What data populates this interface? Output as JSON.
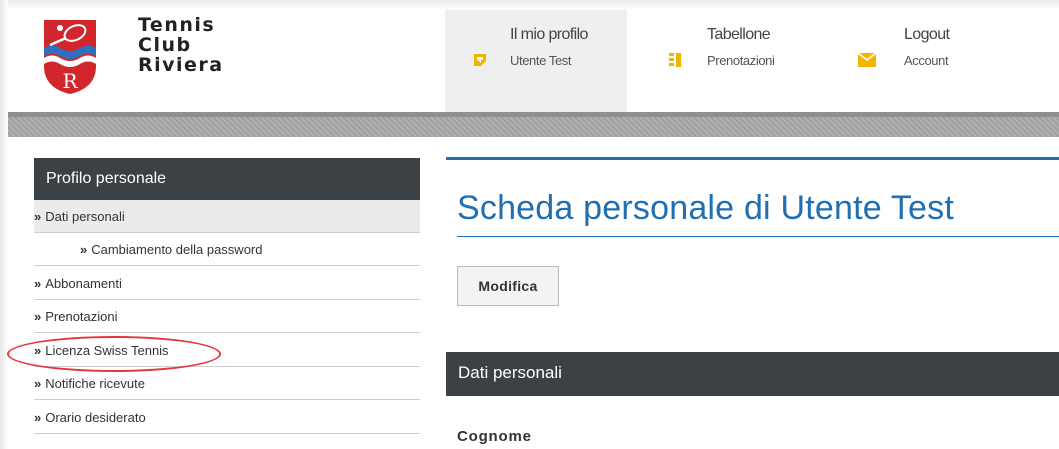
{
  "logo": {
    "line1": "Tennis",
    "line2": "Club",
    "line3": "Riviera",
    "shield_letter": "R",
    "shield_color": "#d0262c"
  },
  "nav": [
    {
      "title": "Il mio profilo",
      "subtitle": "Utente Test",
      "icon": "profile-icon",
      "active": true
    },
    {
      "title": "Tabellone",
      "subtitle": "Prenotazioni",
      "icon": "grid-icon",
      "active": false
    },
    {
      "title": "Logout",
      "subtitle": "Account",
      "icon": "envelope-icon",
      "active": false
    }
  ],
  "sidebar": {
    "heading": "Profilo personale",
    "bullet": "»",
    "items": [
      {
        "label": "Dati personali",
        "current": true
      },
      {
        "label": "Cambiamento della password",
        "sub": true
      },
      {
        "label": "Abbonamenti"
      },
      {
        "label": "Prenotazioni"
      },
      {
        "label": "Licenza Swiss Tennis",
        "highlighted": true
      },
      {
        "label": "Notifiche ricevute"
      },
      {
        "label": "Orario desiderato"
      }
    ]
  },
  "main": {
    "title": "Scheda personale di Utente Test",
    "edit_button": "Modifica",
    "section_title": "Dati personali",
    "first_field_label": "Cognome"
  },
  "colors": {
    "accent_blue": "#1f6fb2",
    "dark_bar": "#3b4145",
    "icon_yellow": "#f2b600",
    "highlight_red": "#e0383e"
  }
}
